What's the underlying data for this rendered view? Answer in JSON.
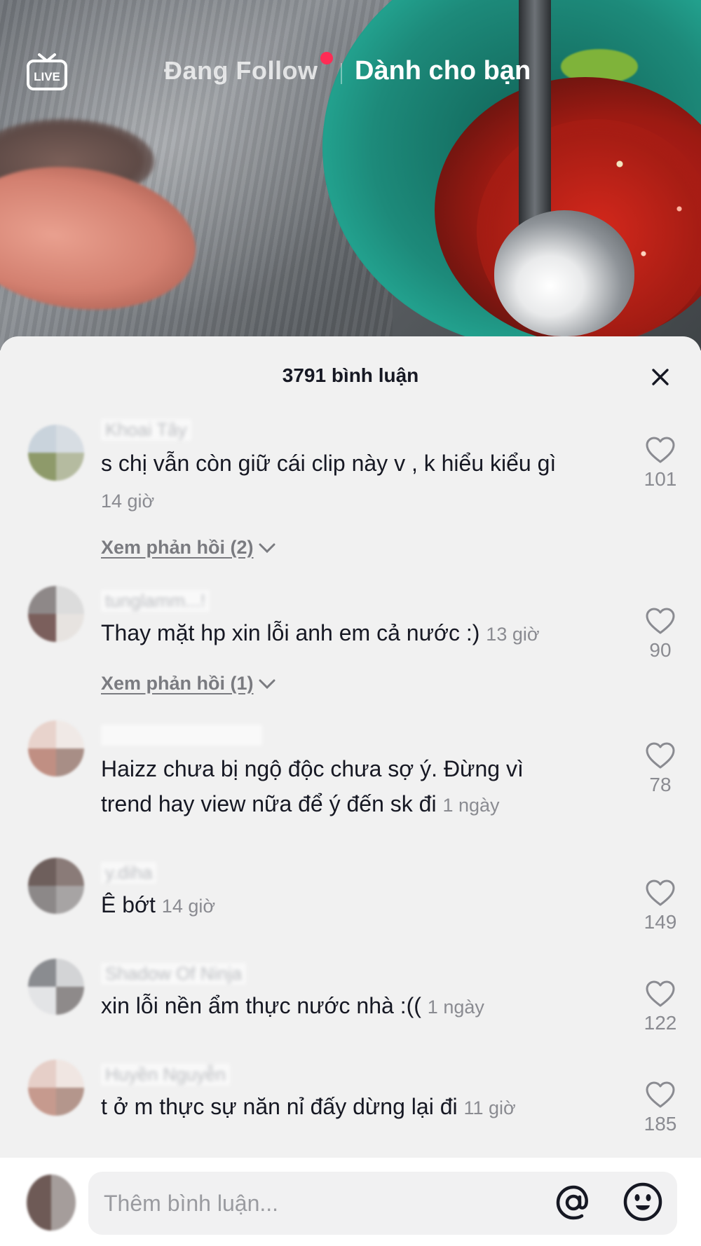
{
  "top_nav": {
    "live_label": "LIVE",
    "following_tab": "Đang Follow",
    "for_you_tab": "Dành cho bạn"
  },
  "comments_sheet": {
    "title": "3791 bình luận",
    "comments": [
      {
        "username": "Khoai Tây",
        "text": "s chị vẫn còn giữ cái clip này v , k hiểu kiểu gì",
        "time": "14 giờ",
        "likes": "101",
        "replies_label": "Xem phản hồi (2)"
      },
      {
        "username": "tunglamm...!",
        "text": "Thay mặt hp xin lỗi anh em cả nước :)",
        "time": "13 giờ",
        "likes": "90",
        "replies_label": "Xem phản hồi (1)"
      },
      {
        "username": "",
        "text_line1": "Haizz chưa bị ngộ độc chưa sợ ý. Đừng vì",
        "text_line2": "trend hay view nữa để ý đến sk đi",
        "time": "1 ngày",
        "likes": "78"
      },
      {
        "username": "y.diha",
        "text": "Ê bớt",
        "time": "14 giờ",
        "likes": "149"
      },
      {
        "username": "Shadow Of Ninja",
        "text": "xin lỗi nền ẩm thực nước nhà :((",
        "time": "1 ngày",
        "likes": "122"
      },
      {
        "username": "Huyền Nguyễn",
        "text": "t ở m thực sự năn nỉ đấy dừng lại đi",
        "time": "11 giờ",
        "likes": "185"
      }
    ]
  },
  "input": {
    "placeholder": "Thêm bình luận..."
  },
  "colors": {
    "accent_dot": "#fe2c55",
    "text_primary": "#161823",
    "text_secondary": "#8a8b91",
    "sheet_bg": "#f1f1f1"
  }
}
